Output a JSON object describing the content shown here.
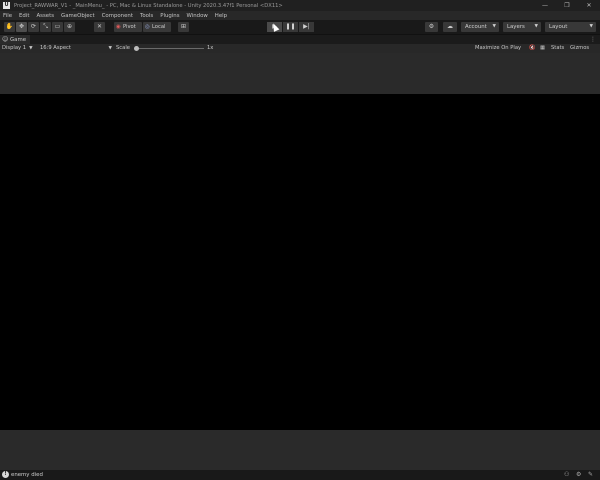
{
  "window": {
    "app_badge": "U",
    "title": "Project_RAWWAR_V1 - _MainMenu_ - PC, Mac & Linux Standalone - Unity 2020.3.47f1 Personal <DX11>",
    "controls": [
      "—",
      "❐",
      "✕"
    ]
  },
  "menubar": {
    "items": [
      "File",
      "Edit",
      "Assets",
      "GameObject",
      "Component",
      "Tools",
      "Plugins",
      "Window",
      "Help"
    ]
  },
  "toolbar": {
    "tools": [
      "✋",
      "✥",
      "⟳",
      "⤡",
      "▭",
      "⊕",
      "✕"
    ],
    "pivot_label": "Pivot",
    "pivot_icon": "◉",
    "local_label": "Local",
    "local_icon": "◎",
    "grid_icon": "⊞",
    "play_icon": "▶",
    "pause_icon": "❚❚",
    "step_icon": "▶|",
    "collab_icon": "⚙",
    "cloud_icon": "☁",
    "account_label": "Account",
    "layers_label": "Layers",
    "layout_label": "Layout",
    "caret": "▼"
  },
  "game_view": {
    "tab_label": "Game",
    "tab_icon": "☺",
    "tab_menu": "⋮",
    "display_label": "Display 1",
    "aspect_label": "16:9 Aspect",
    "scale_label": "Scale",
    "scale_value": "1x",
    "maximize_label": "Maximize On Play",
    "mute_icon": "🔇",
    "stats_icon": "▦",
    "stats_label": "Stats",
    "gizmos_label": "Gizmos",
    "caret": "▼"
  },
  "statusbar": {
    "icon": "!",
    "message": "enemy died",
    "right_icons": [
      "⚇",
      "⚙",
      "✎"
    ]
  }
}
